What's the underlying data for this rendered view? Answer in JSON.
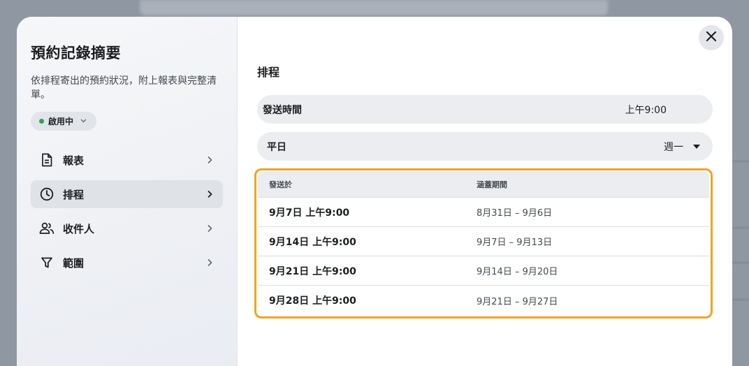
{
  "sidebar": {
    "title": "預約記錄摘要",
    "description": "依排程寄出的預約狀況，附上報表與完整清單。",
    "status": "啟用中",
    "items": [
      {
        "label": "報表",
        "icon": "document-icon"
      },
      {
        "label": "排程",
        "icon": "clock-icon"
      },
      {
        "label": "收件人",
        "icon": "people-icon"
      },
      {
        "label": "範圍",
        "icon": "filter-icon"
      }
    ]
  },
  "main": {
    "section_title": "排程",
    "send_time": {
      "label": "發送時間",
      "value": "上午9:00"
    },
    "weekday": {
      "label": "平日",
      "value": "週一"
    },
    "table": {
      "headers": [
        "發送於",
        "涵蓋期間"
      ],
      "rows": [
        {
          "send": "9月7日 上午9:00",
          "period": "8月31日 – 9月6日"
        },
        {
          "send": "9月14日 上午9:00",
          "period": "9月7日 – 9月13日"
        },
        {
          "send": "9月21日 上午9:00",
          "period": "9月14日 – 9月20日"
        },
        {
          "send": "9月28日 上午9:00",
          "period": "9月21日 – 9月27日"
        }
      ]
    }
  },
  "colors": {
    "highlight": "#f6a21b",
    "status_dot": "#31a24c"
  }
}
